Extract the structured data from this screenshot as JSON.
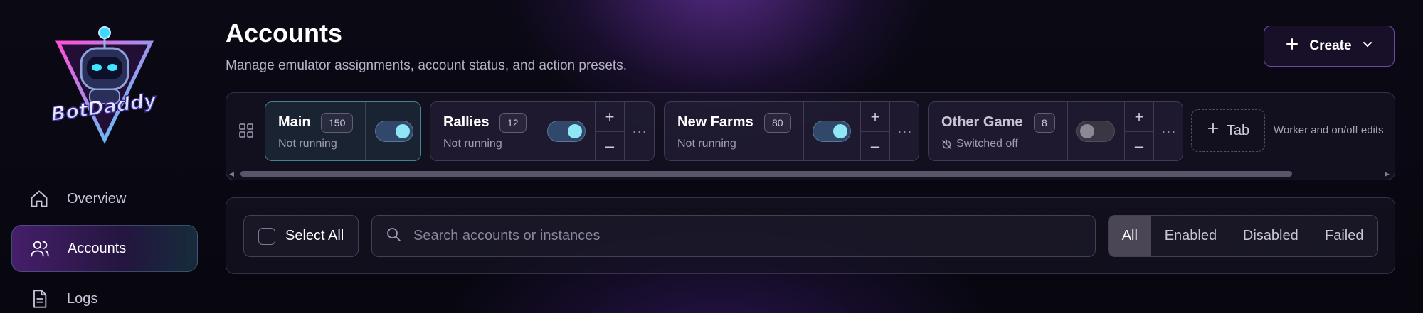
{
  "brand": {
    "logo_text": "BotDaddy"
  },
  "sidebar": {
    "items": [
      {
        "label": "Overview",
        "icon": "home-icon",
        "active": false
      },
      {
        "label": "Accounts",
        "icon": "users-icon",
        "active": true
      },
      {
        "label": "Logs",
        "icon": "file-text-icon",
        "active": false
      }
    ]
  },
  "header": {
    "title": "Accounts",
    "subtitle": "Manage emulator assignments, account status, and action presets.",
    "create_label": "Create"
  },
  "tabs": [
    {
      "name": "Main",
      "count": "150",
      "status": "Not running",
      "enabled": true,
      "selected": true
    },
    {
      "name": "Rallies",
      "count": "12",
      "status": "Not running",
      "enabled": true,
      "selected": false
    },
    {
      "name": "New Farms",
      "count": "80",
      "status": "Not running",
      "enabled": true,
      "selected": false
    },
    {
      "name": "Other Game",
      "count": "8",
      "status": "Switched off",
      "enabled": false,
      "selected": false
    }
  ],
  "add_tab_label": "Tab",
  "tabs_hint": "Worker and on/off edits",
  "filters": {
    "select_all_label": "Select All",
    "search_placeholder": "Search accounts or instances",
    "segments": [
      "All",
      "Enabled",
      "Disabled",
      "Failed"
    ],
    "active_segment": "All"
  },
  "colors": {
    "accent_purple": "#8a4fe0",
    "accent_cyan": "#8fe6f5",
    "background": "#07060c"
  }
}
